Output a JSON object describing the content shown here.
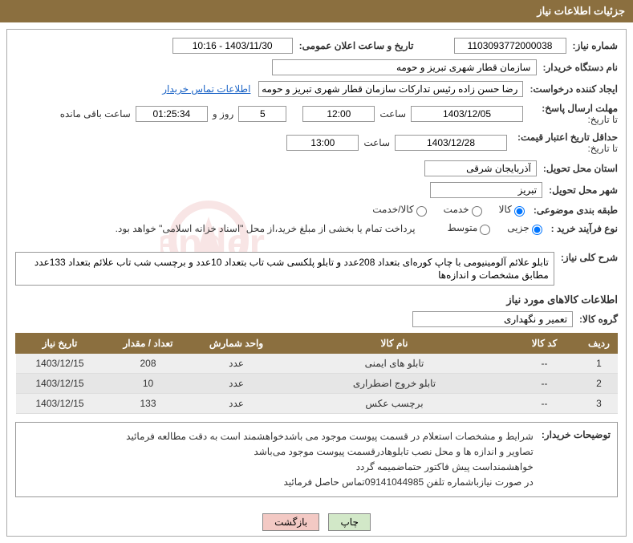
{
  "header_title": "جزئیات اطلاعات نیاز",
  "labels": {
    "need_no": "شماره نیاز:",
    "announce_dt": "تاریخ و ساعت اعلان عمومی:",
    "buyer_org": "نام دستگاه خریدار:",
    "requester": "ایجاد کننده درخواست:",
    "contact_link": "اطلاعات تماس خریدار",
    "deadline": "مهلت ارسال پاسخ:",
    "until": "تا تاریخ:",
    "time": "ساعت",
    "days_and": "روز و",
    "remain": "ساعت باقی مانده",
    "validity": "حداقل تاریخ اعتبار قیمت:",
    "delivery_prov": "استان محل تحویل:",
    "delivery_city": "شهر محل تحویل:",
    "category": "طبقه بندی موضوعی:",
    "process": "نوع فرآیند خرید :",
    "pay_note": "پرداخت تمام یا بخشی از مبلغ خرید،از محل \"اسناد خزانه اسلامی\" خواهد بود.",
    "need_desc": "شرح کلی نیاز:",
    "items_sec": "اطلاعات کالاهای مورد نیاز",
    "goods_grp": "گروه کالا:",
    "buyer_notes": "توضیحات خریدار:"
  },
  "values": {
    "need_no": "1103093772000038",
    "announce_dt": "1403/11/30 - 10:16",
    "buyer_org": "سازمان قطار شهری تبریز و حومه",
    "requester": "رضا حسن زاده رئیس تدارکات سازمان قطار شهری تبریز و حومه",
    "deadline_date": "1403/12/05",
    "deadline_time": "12:00",
    "days": "5",
    "remain_time": "01:25:34",
    "validity_date": "1403/12/28",
    "validity_time": "13:00",
    "prov": "آذربایجان شرقی",
    "city": "تبریز",
    "need_desc": "تابلو علائم آلومینیومی با چاپ کوره‌ای بتعداد 208عدد و تابلو پلکسی شب تاب بتعداد 10عدد و برچسب شب تاب علائم بتعداد 133عدد مطابق مشخصات و اندازه‌ها",
    "goods_grp": "تعمیر و نگهداری"
  },
  "radios": {
    "cat": {
      "goods": "کالا",
      "service": "خدمت",
      "both": "کالا/خدمت"
    },
    "proc": {
      "minor": "جزیی",
      "medium": "متوسط"
    }
  },
  "table": {
    "headers": {
      "row": "ردیف",
      "code": "کد کالا",
      "name": "نام کالا",
      "unit": "واحد شمارش",
      "qty": "تعداد / مقدار",
      "date": "تاریخ نیاز"
    },
    "rows": [
      {
        "row": "1",
        "code": "--",
        "name": "تابلو های ایمنی",
        "unit": "عدد",
        "qty": "208",
        "date": "1403/12/15"
      },
      {
        "row": "2",
        "code": "--",
        "name": "تابلو خروج اضطراری",
        "unit": "عدد",
        "qty": "10",
        "date": "1403/12/15"
      },
      {
        "row": "3",
        "code": "--",
        "name": "برچسب عکس",
        "unit": "عدد",
        "qty": "133",
        "date": "1403/12/15"
      }
    ]
  },
  "notes": {
    "l1": "شرایط و مشخصات استعلام در قسمت پیوست موجود می باشدخواهشمند است به دقت مطالعه فرمائید",
    "l2": "تصاویر و اندازه ها و محل نصب تابلوهادرقسمت پیوست موجود می‌باشد",
    "l3": "خواهشمنداست پیش فاکتور حتماضمیمه گردد",
    "l4": "در صورت نیازباشماره تلفن 09141044985تماس حاصل فرمائید"
  },
  "buttons": {
    "print": "چاپ",
    "back": "بازگشت"
  }
}
